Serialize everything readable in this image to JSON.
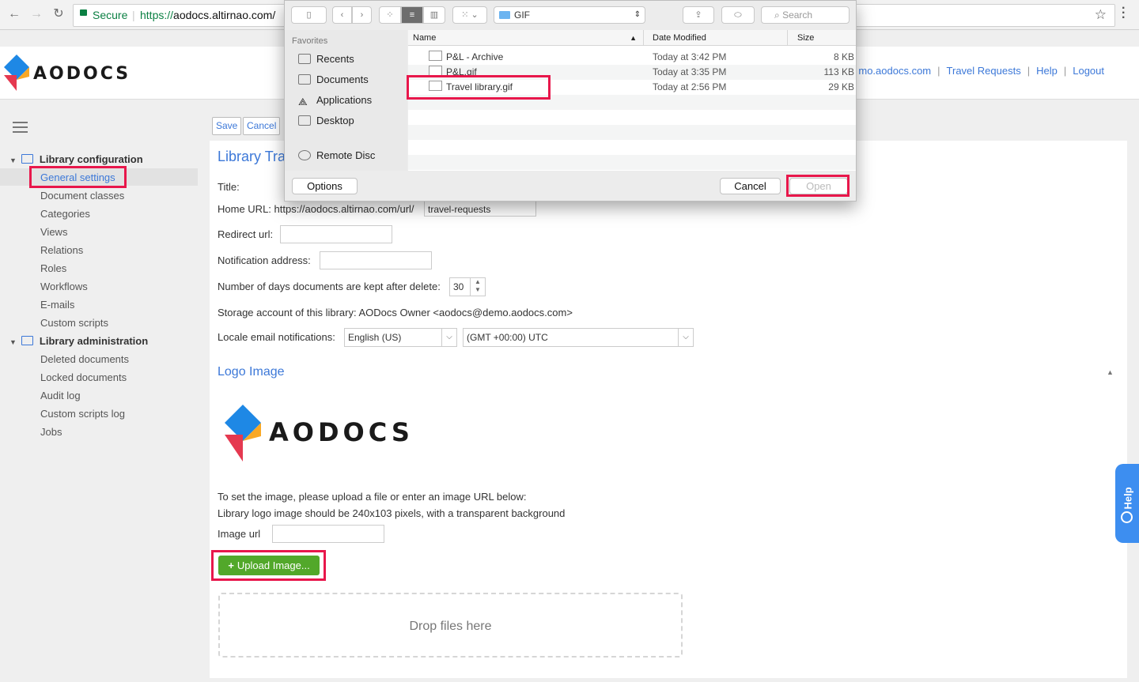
{
  "browser": {
    "secure_label": "Secure",
    "url_prefix": "https://",
    "url_host": "aodocs.altirnao.com/"
  },
  "header": {
    "logo_text": "AODOCS",
    "user_email_partial": "mo.aodocs.com",
    "links": [
      "Travel Requests",
      "Help",
      "Logout"
    ]
  },
  "sidebar": {
    "groups": [
      {
        "label": "Library configuration",
        "items": [
          "General settings",
          "Document classes",
          "Categories",
          "Views",
          "Relations",
          "Roles",
          "Workflows",
          "E-mails",
          "Custom scripts"
        ]
      },
      {
        "label": "Library administration",
        "items": [
          "Deleted documents",
          "Locked documents",
          "Audit log",
          "Custom scripts log",
          "Jobs"
        ]
      }
    ]
  },
  "toolbar": {
    "save_label": "Save",
    "cancel_label": "Cancel"
  },
  "page_title_partial": "Library Tra",
  "form": {
    "title_label": "Title:",
    "home_url_label": "Home URL: https://aodocs.altirnao.com/url/",
    "home_url_value": "travel-requests",
    "redirect_label": "Redirect url:",
    "notification_label": "Notification address:",
    "days_label": "Number of days documents are kept after delete:",
    "days_value": "30",
    "storage_text": "Storage account of this library: AODocs Owner <aodocs@demo.aodocs.com>",
    "locale_label": "Locale email notifications:",
    "locale_value": "English (US)",
    "timezone_value": "(GMT +00:00) UTC"
  },
  "logo_section": {
    "title": "Logo Image",
    "logo_text": "AODOCS",
    "instruction_1": "To set the image, please upload a file or enter an image URL below:",
    "instruction_2": "Library logo image should be 240x103 pixels, with a transparent background",
    "image_url_label": "Image url",
    "upload_label": "Upload Image...",
    "dropzone_label": "Drop files here"
  },
  "help_tab_label": "Help",
  "file_dialog": {
    "location": "GIF",
    "search_placeholder": "Search",
    "favorites_header": "Favorites",
    "favorites": [
      "Recents",
      "Documents",
      "Applications",
      "Desktop"
    ],
    "devices": [
      "Remote Disc"
    ],
    "columns": {
      "name": "Name",
      "date": "Date Modified",
      "size": "Size"
    },
    "files": [
      {
        "name": "P&L - Archive",
        "date": "Today at 3:42 PM",
        "size": "8 KB"
      },
      {
        "name": "P&L.gif",
        "date": "Today at 3:35 PM",
        "size": "113 KB"
      },
      {
        "name": "Travel library.gif",
        "date": "Today at 2:56 PM",
        "size": "29 KB"
      }
    ],
    "options_label": "Options",
    "cancel_label": "Cancel",
    "open_label": "Open"
  },
  "colors": {
    "accent": "#3c78d8",
    "highlight": "#e8174b",
    "upload_green": "#52a82a",
    "logo_blue": "#1e88e5",
    "logo_red": "#e53950"
  }
}
